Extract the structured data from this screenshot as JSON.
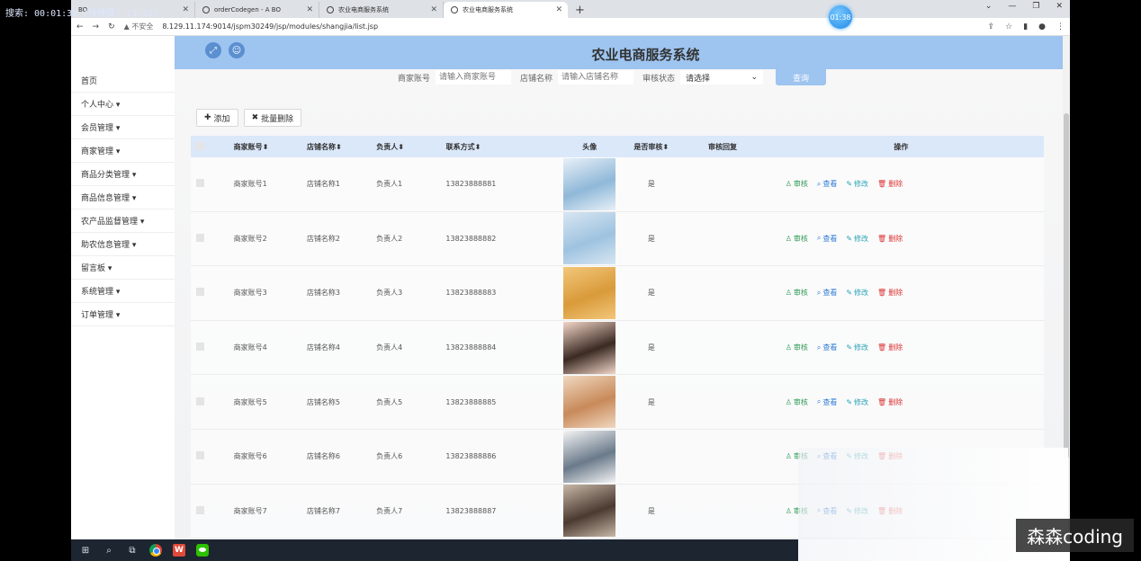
{
  "overlay": {
    "recorder_text": "搜索: 00:01:38 (快捷键) (3:15)",
    "badge": "01:38"
  },
  "watermark": "森森coding",
  "tabs": [
    {
      "label": "BO"
    },
    {
      "label": "orderCodegen - A BO"
    },
    {
      "label": "农业电商服务系统"
    },
    {
      "label": "农业电商服务系统"
    }
  ],
  "addressbar": {
    "insecure": "不安全",
    "url": "8.129.11.174:9014/jspm30249/jsp/modules/shangjia/list.jsp"
  },
  "header": {
    "title": "农业电商服务系统"
  },
  "sidebar": {
    "items": [
      {
        "label": "首页"
      },
      {
        "label": "个人中心 ▾"
      },
      {
        "label": "会员管理 ▾"
      },
      {
        "label": "商家管理 ▾"
      },
      {
        "label": "商品分类管理 ▾"
      },
      {
        "label": "商品信息管理 ▾"
      },
      {
        "label": "农产品监督管理 ▾"
      },
      {
        "label": "助农信息管理 ▾"
      },
      {
        "label": "留言板 ▾"
      },
      {
        "label": "系统管理 ▾"
      },
      {
        "label": "订单管理 ▾"
      }
    ]
  },
  "search": {
    "account_label": "商家账号",
    "account_placeholder": "请输入商家账号",
    "shop_label": "店铺名称",
    "shop_placeholder": "请输入店铺名称",
    "status_label": "审核状态",
    "status_value": "请选择",
    "query_button": "查询"
  },
  "toolbar": {
    "add": "添加",
    "batch_delete": "批量删除"
  },
  "table": {
    "headers": {
      "account": "商家账号",
      "shop": "店铺名称",
      "owner": "负责人",
      "phone": "联系方式",
      "avatar": "头像",
      "audit": "是否审核",
      "reply": "审核回复",
      "ops": "操作"
    },
    "ops": {
      "audit": "审核",
      "view": "查看",
      "edit": "修改",
      "del": "删除"
    },
    "rows": [
      {
        "account": "商家账号1",
        "shop": "店铺名称1",
        "owner": "负责人1",
        "phone": "13823888881",
        "audit": "是",
        "reply": "",
        "colors": [
          "#8fb8d8",
          "#e8f0f8"
        ]
      },
      {
        "account": "商家账号2",
        "shop": "店铺名称2",
        "owner": "负责人2",
        "phone": "13823888882",
        "audit": "是",
        "reply": "",
        "colors": [
          "#9ec3e0",
          "#d8e6f2"
        ]
      },
      {
        "account": "商家账号3",
        "shop": "店铺名称3",
        "owner": "负责人3",
        "phone": "13823888883",
        "audit": "是",
        "reply": "",
        "colors": [
          "#d99a3a",
          "#f2c77a"
        ]
      },
      {
        "account": "商家账号4",
        "shop": "店铺名称4",
        "owner": "负责人4",
        "phone": "13823888884",
        "audit": "是",
        "reply": "",
        "colors": [
          "#3a2a22",
          "#f3d6c8"
        ]
      },
      {
        "account": "商家账号5",
        "shop": "店铺名称5",
        "owner": "负责人5",
        "phone": "13823888885",
        "audit": "是",
        "reply": "",
        "colors": [
          "#c88a5a",
          "#f0d8c0"
        ]
      },
      {
        "account": "商家账号6",
        "shop": "店铺名称6",
        "owner": "负责人6",
        "phone": "13823888886",
        "audit": "",
        "reply": "",
        "colors": [
          "#6a7a8a",
          "#f4f4f4"
        ]
      },
      {
        "account": "商家账号7",
        "shop": "店铺名称7",
        "owner": "负责人7",
        "phone": "13823888887",
        "audit": "是",
        "reply": "",
        "colors": [
          "#4a3a30",
          "#c8b8a8"
        ]
      }
    ]
  }
}
